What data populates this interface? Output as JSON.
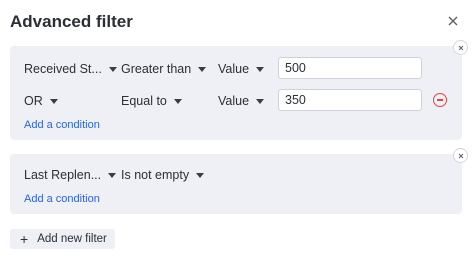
{
  "dialog": {
    "title": "Advanced filter",
    "close_icon": "close-icon"
  },
  "groups": [
    {
      "conditions": [
        {
          "field": "Received St...",
          "operator": "Greater than",
          "value_type": "Value",
          "value": "500"
        },
        {
          "connector": "OR",
          "operator": "Equal to",
          "value_type": "Value",
          "value": "350"
        }
      ],
      "add_condition_label": "Add a condition"
    },
    {
      "conditions": [
        {
          "field": "Last Replen...",
          "operator": "Is not empty"
        }
      ],
      "add_condition_label": "Add a condition"
    }
  ],
  "add_filter_label": "Add new filter",
  "colors": {
    "accent": "#2c63d6",
    "remove": "#e0463f",
    "group_bg": "#eef0f6"
  }
}
